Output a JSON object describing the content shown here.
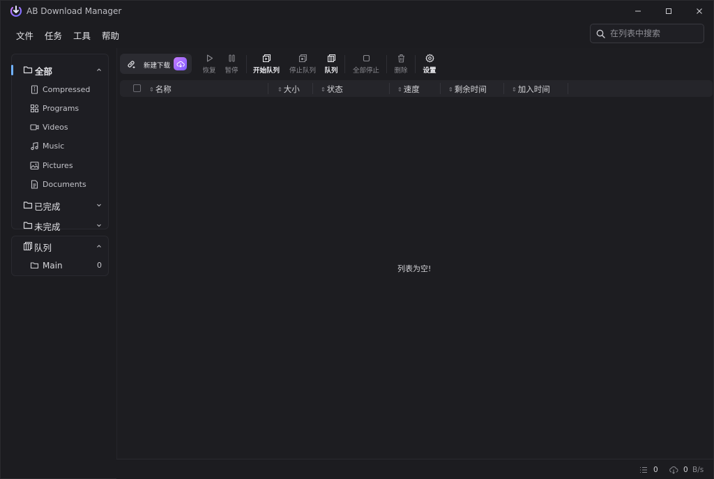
{
  "app": {
    "title": "AB Download Manager"
  },
  "menu": [
    "文件",
    "任务",
    "工具",
    "帮助"
  ],
  "search": {
    "placeholder": "在列表中搜索"
  },
  "categories": {
    "all_label": "全部",
    "items": [
      {
        "label": "Compressed",
        "icon": "compressed-file-icon"
      },
      {
        "label": "Programs",
        "icon": "programs-icon"
      },
      {
        "label": "Videos",
        "icon": "video-icon"
      },
      {
        "label": "Music",
        "icon": "music-icon"
      },
      {
        "label": "Pictures",
        "icon": "picture-icon"
      },
      {
        "label": "Documents",
        "icon": "document-icon"
      }
    ],
    "finished_label": "已完成",
    "unfinished_label": "未完成"
  },
  "queues": {
    "title": "队列",
    "items": [
      {
        "label": "Main",
        "count": "0"
      }
    ]
  },
  "toolbar": {
    "new_download": "新建下载",
    "resume": "恢复",
    "pause": "暂停",
    "start_queue": "开始队列",
    "stop_queue": "停止队列",
    "queue": "队列",
    "stop_all": "全部停止",
    "delete": "删除",
    "settings": "设置"
  },
  "table": {
    "columns": [
      "名称",
      "大小",
      "状态",
      "速度",
      "剩余时间",
      "加入时间"
    ],
    "empty_message": "列表为空!"
  },
  "status": {
    "active_count": "0",
    "speed_value": "0",
    "speed_unit": "B/s"
  },
  "colors": {
    "accent": "#6fb1ff",
    "brand_gradient_start": "#c77bff",
    "brand_gradient_end": "#7d5cff",
    "background": "#1c1c20"
  }
}
